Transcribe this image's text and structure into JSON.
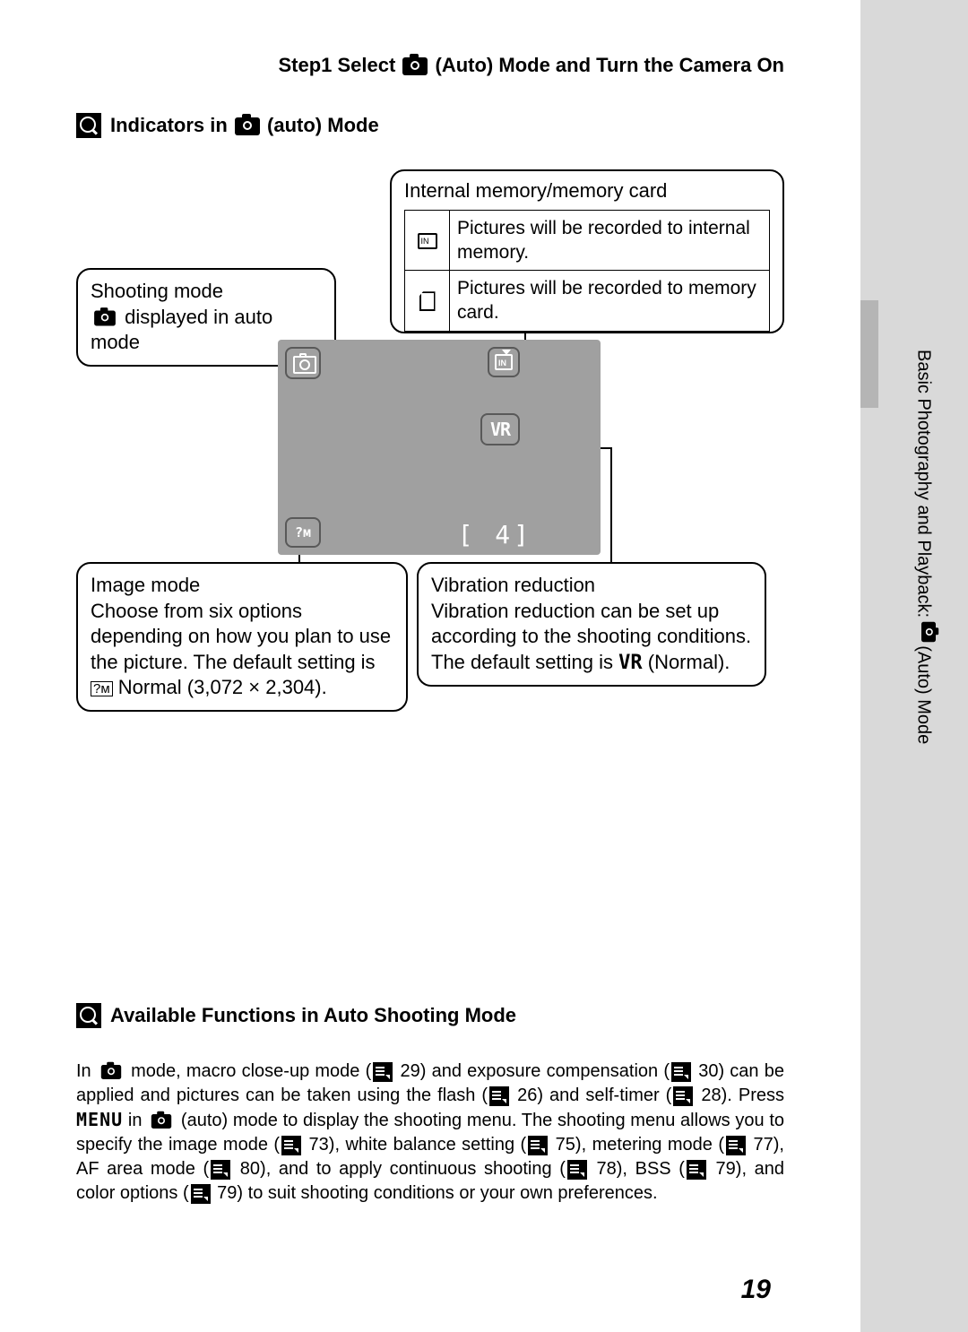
{
  "header": "Step1 Select    (Auto) Mode and Turn the Camera On",
  "section1_title_a": "Indicators in ",
  "section1_title_b": " (auto) Mode",
  "callouts": {
    "memory": {
      "title": "Internal memory/memory card",
      "row1": "Pictures will be recorded to internal memory.",
      "row2": "Pictures will be recorded to memory card."
    },
    "shooting": {
      "title": "Shooting mode",
      "line2": " displayed in auto mode"
    },
    "image_mode": {
      "title": "Image mode",
      "body_a": "Choose from six options depending on how you plan to use the picture. The default setting is ",
      "body_b": " Normal (3,072 × 2,304)."
    },
    "vibration": {
      "title": "Vibration reduction",
      "body_a": "Vibration reduction can be set up according to the shooting conditions. The default setting is ",
      "body_b": " (Normal)."
    }
  },
  "screen": {
    "vr": "VR",
    "count": "[   4]"
  },
  "side_label": "Basic Photography and Playback:    (Auto) Mode",
  "section2_title": "Available Functions in Auto Shooting Mode",
  "body": {
    "p1a": "In ",
    "p1b": " mode, macro close-up mode (",
    "p1c": " 29) and exposure compensation (",
    "p1d": " 30) can be applied and pictures can be taken using the flash (",
    "p1e": " 26) and self-timer (",
    "p1f": " 28). Press ",
    "p1menu": "MENU",
    "p1g": " in ",
    "p1h": " (auto) mode to display the shooting menu. The shooting menu allows you to specify the image mode (",
    "p1i": " 73), white balance setting (",
    "p1j": " 75), metering mode (",
    "p1k": " 77), AF area mode (",
    "p1l": " 80), and to apply continuous shooting (",
    "p1m": " 78), BSS (",
    "p1n": " 79), and color options (",
    "p1o": " 79) to suit shooting conditions or your own preferences."
  },
  "page_number": "19"
}
